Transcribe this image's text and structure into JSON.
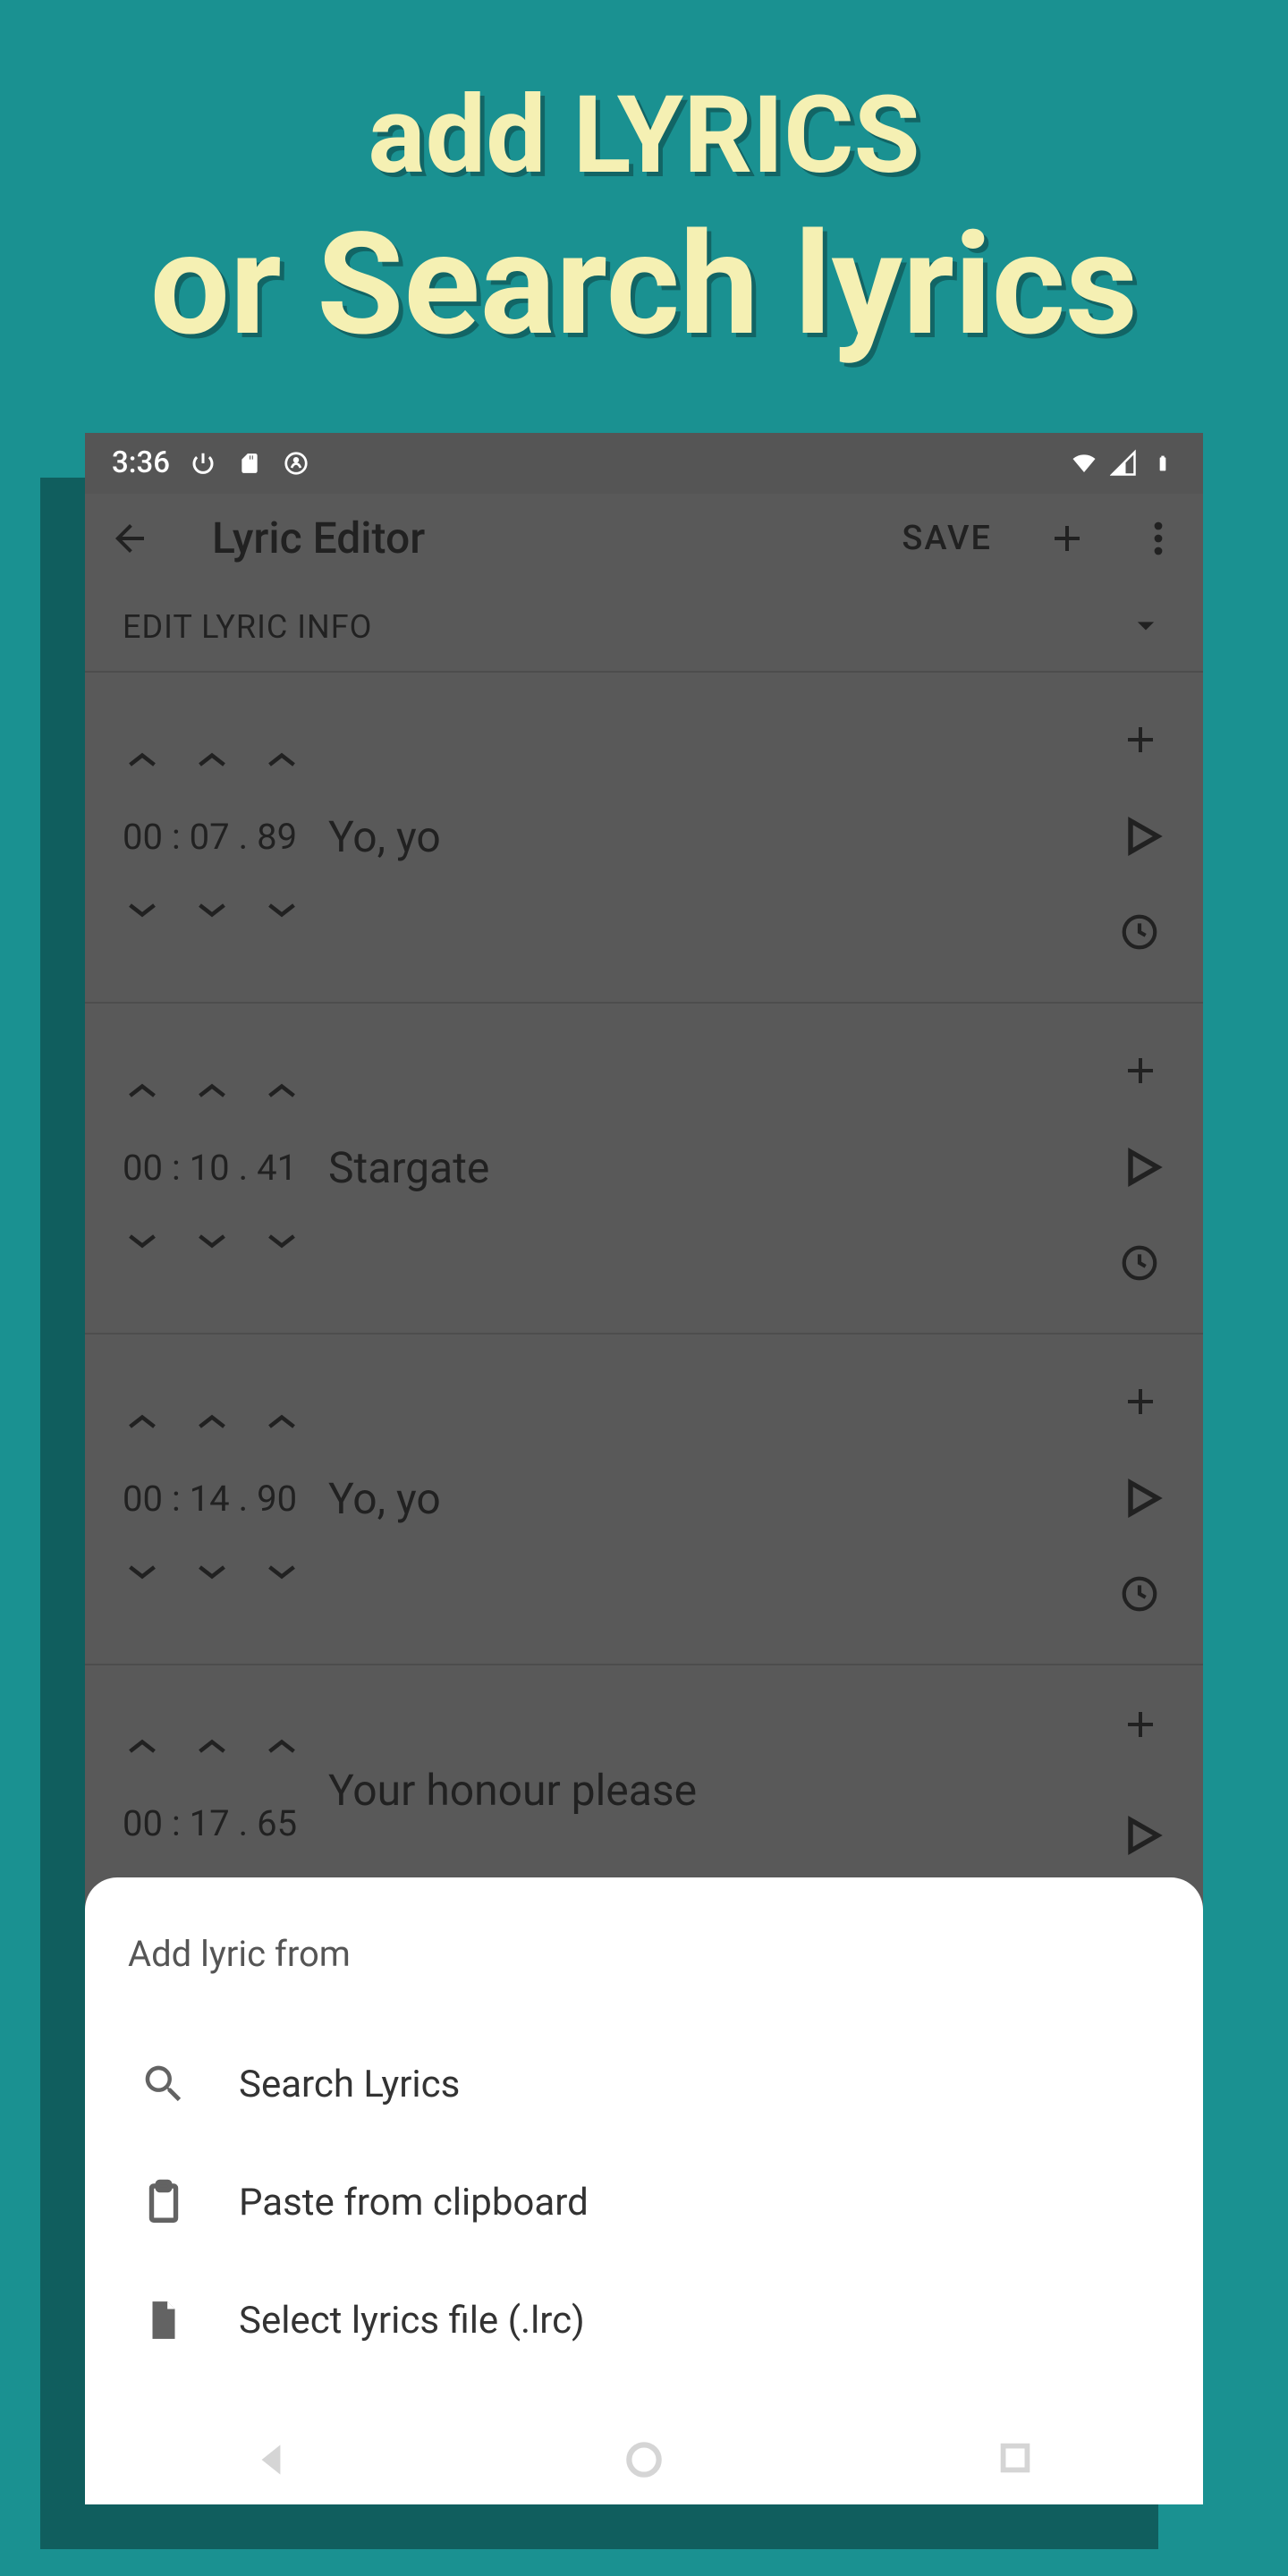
{
  "promo": {
    "line1": "add LYRICS",
    "line2": "or Search lyrics"
  },
  "status": {
    "time": "3:36"
  },
  "appBar": {
    "title": "Lyric Editor",
    "saveLabel": "SAVE"
  },
  "sectionHeader": "EDIT LYRIC INFO",
  "rows": [
    {
      "mm": "00",
      "ss": "07",
      "cs": "89",
      "text": "Yo, yo"
    },
    {
      "mm": "00",
      "ss": "10",
      "cs": "41",
      "text": "Stargate"
    },
    {
      "mm": "00",
      "ss": "14",
      "cs": "90",
      "text": "Yo, yo"
    },
    {
      "mm": "00",
      "ss": "17",
      "cs": "65",
      "text": "Your honour please"
    }
  ],
  "sheet": {
    "title": "Add lyric from",
    "items": [
      {
        "label": "Search Lyrics",
        "icon": "search"
      },
      {
        "label": "Paste from clipboard",
        "icon": "clipboard"
      },
      {
        "label": "Select lyrics file (.lrc)",
        "icon": "file"
      }
    ]
  }
}
